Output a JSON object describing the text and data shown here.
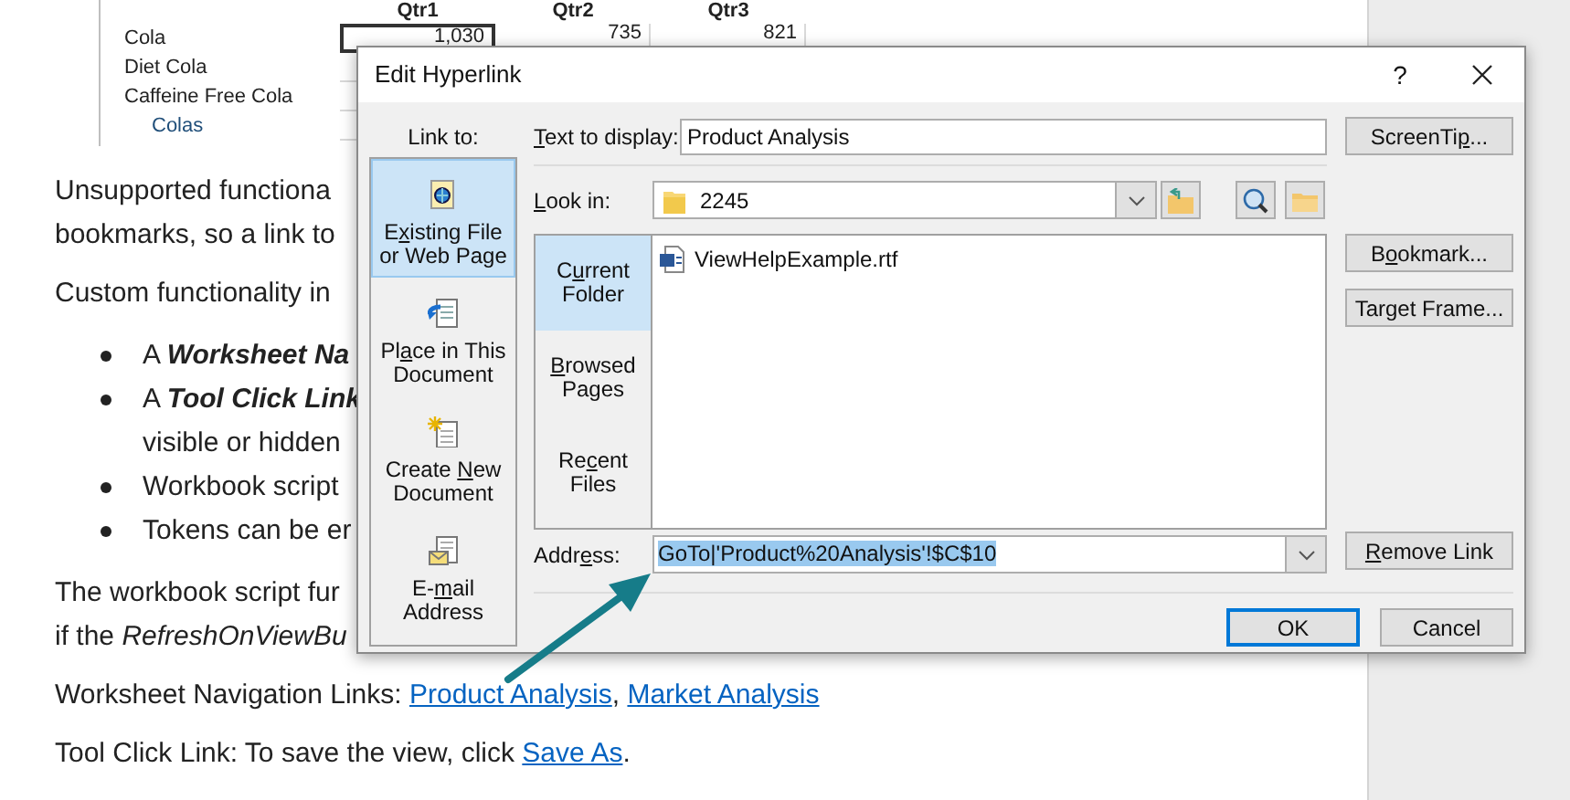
{
  "document": {
    "sheet": {
      "columns": [
        "Qtr1",
        "Qtr2",
        "Qtr3"
      ],
      "rows": [
        {
          "label": "Cola",
          "kind": "item",
          "cells": [
            {
              "text": "1,030",
              "selected": true
            },
            {
              "text": "735",
              "selected": false
            },
            {
              "text": "821",
              "selected": false
            }
          ]
        },
        {
          "label": "Diet Cola",
          "kind": "item"
        },
        {
          "label": "Caffeine Free Cola",
          "kind": "item"
        },
        {
          "label": "Colas",
          "kind": "total"
        }
      ]
    },
    "blocks": [
      {
        "kind": "paragraph",
        "lines": [
          "Unsupported functiona",
          "bookmarks, so a link to"
        ]
      },
      {
        "kind": "paragraph",
        "lines": [
          "Custom functionality in"
        ]
      },
      {
        "kind": "bullets",
        "items": [
          {
            "lines": [
              "A **Worksheet Na**"
            ]
          },
          {
            "lines": [
              "A **Tool Click Link**",
              "visible or hidden"
            ]
          },
          {
            "lines": [
              "Workbook script"
            ]
          },
          {
            "lines": [
              "Tokens can be er"
            ]
          }
        ]
      },
      {
        "kind": "paragraph",
        "lines": [
          "The workbook script fur",
          "if the *RefreshOnViewBu*"
        ]
      },
      {
        "kind": "sentence",
        "parts": [
          {
            "text": "Worksheet Navigation Links: ",
            "link": false
          },
          {
            "text": "Product Analysis",
            "link": true
          },
          {
            "text": ", ",
            "link": false
          },
          {
            "text": "Market Analysis",
            "link": true
          }
        ]
      },
      {
        "kind": "sentence",
        "parts": [
          {
            "text": "Tool Click Link: To save the view, click ",
            "link": false
          },
          {
            "text": "Save As",
            "link": true
          },
          {
            "text": ".",
            "link": false
          }
        ]
      }
    ]
  },
  "dialog": {
    "title": "Edit Hyperlink",
    "help_button": "?",
    "link_to_label": "Link to:",
    "link_to": [
      {
        "kind": "existing",
        "label": {
          "before": "E",
          "key": "x",
          "after": "isting File or Web Page"
        },
        "selected": true
      },
      {
        "kind": "place",
        "label": {
          "before": "Pl",
          "key": "a",
          "after": "ce in This Document"
        },
        "selected": false
      },
      {
        "kind": "new",
        "label": {
          "before": "Create ",
          "key": "N",
          "after": "ew Document"
        },
        "selected": false
      },
      {
        "kind": "email",
        "label": {
          "before": "E-",
          "key": "m",
          "after": "ail Address"
        },
        "selected": false
      }
    ],
    "text_to_display": {
      "label": {
        "key": "T",
        "after": "ext to display:"
      },
      "value": "Product Analysis"
    },
    "screentip_button": {
      "before": "ScreenTi",
      "key": "p",
      "after": "..."
    },
    "look_in": {
      "label": {
        "key": "L",
        "after": "ook in:"
      },
      "value": "2245"
    },
    "browse_tabs": [
      {
        "label": {
          "before": "C",
          "key": "u",
          "after": "rrent Folder"
        },
        "selected": true
      },
      {
        "label": {
          "key": "B",
          "after": "rowsed Pages"
        },
        "selected": false
      },
      {
        "label": {
          "before": "Re",
          "key": "c",
          "after": "ent Files"
        },
        "selected": false
      }
    ],
    "files": [
      "ViewHelpExample.rtf"
    ],
    "bookmark_button": {
      "before": "B",
      "key": "o",
      "after": "okmark..."
    },
    "target_frame_button": {
      "before": "Tar",
      "key": "g",
      "after": "et Frame..."
    },
    "address": {
      "label": {
        "before": "Addr",
        "key": "e",
        "after": "ss:"
      },
      "value": "GoTo|'Product%20Analysis'!$C$10",
      "text_selected": true
    },
    "remove_link_button": {
      "key": "R",
      "after": "emove Link"
    },
    "ok_button": {
      "label": "OK",
      "default": true
    },
    "cancel_button": "Cancel"
  }
}
